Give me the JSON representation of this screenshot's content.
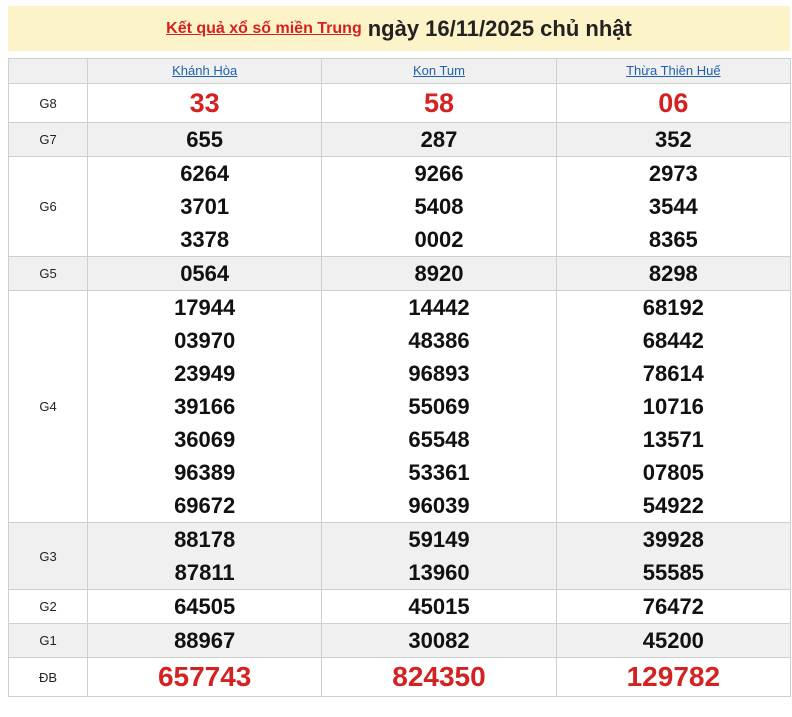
{
  "header": {
    "link_text": "Kết quả xổ số miền Trung",
    "date_text": "ngày 16/11/2025 chủ nhật"
  },
  "provinces": [
    "Khánh Hòa",
    "Kon Tum",
    "Thừa Thiên Huế"
  ],
  "colors": {
    "red": "#d42222",
    "link_blue": "#1f5fb0",
    "header_bg": "#fcf4c8",
    "shade": "#f0f0f0"
  },
  "prizes": [
    {
      "label": "G8",
      "values": [
        [
          "33"
        ],
        [
          "58"
        ],
        [
          "06"
        ]
      ]
    },
    {
      "label": "G7",
      "values": [
        [
          "655"
        ],
        [
          "287"
        ],
        [
          "352"
        ]
      ]
    },
    {
      "label": "G6",
      "values": [
        [
          "6264",
          "3701",
          "3378"
        ],
        [
          "9266",
          "5408",
          "0002"
        ],
        [
          "2973",
          "3544",
          "8365"
        ]
      ]
    },
    {
      "label": "G5",
      "values": [
        [
          "0564"
        ],
        [
          "8920"
        ],
        [
          "8298"
        ]
      ]
    },
    {
      "label": "G4",
      "values": [
        [
          "17944",
          "03970",
          "23949",
          "39166",
          "36069",
          "96389",
          "69672"
        ],
        [
          "14442",
          "48386",
          "96893",
          "55069",
          "65548",
          "53361",
          "96039"
        ],
        [
          "68192",
          "68442",
          "78614",
          "10716",
          "13571",
          "07805",
          "54922"
        ]
      ]
    },
    {
      "label": "G3",
      "values": [
        [
          "88178",
          "87811"
        ],
        [
          "59149",
          "13960"
        ],
        [
          "39928",
          "55585"
        ]
      ]
    },
    {
      "label": "G2",
      "values": [
        [
          "64505"
        ],
        [
          "45015"
        ],
        [
          "76472"
        ]
      ]
    },
    {
      "label": "G1",
      "values": [
        [
          "88967"
        ],
        [
          "30082"
        ],
        [
          "45200"
        ]
      ]
    },
    {
      "label": "ĐB",
      "values": [
        [
          "657743"
        ],
        [
          "824350"
        ],
        [
          "129782"
        ]
      ]
    }
  ]
}
